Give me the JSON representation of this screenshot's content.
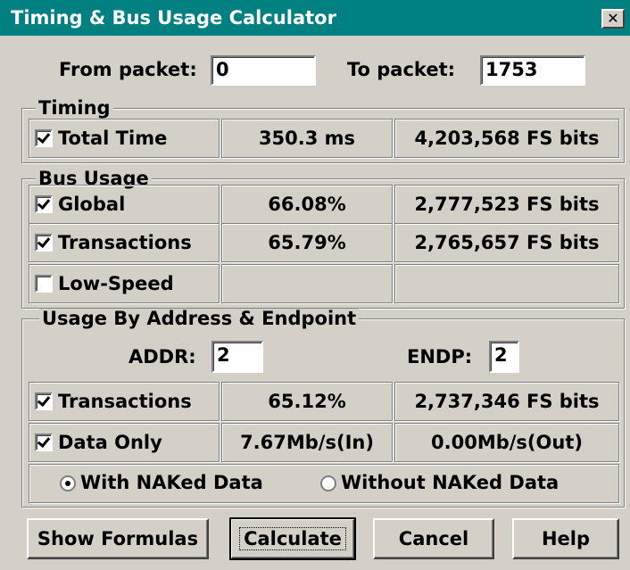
{
  "window": {
    "title": "Timing & Bus Usage Calculator",
    "close_symbol": "✕"
  },
  "range": {
    "from_label": "From packet:",
    "from_value": "0",
    "to_label": "To packet:",
    "to_value": "1753"
  },
  "timing": {
    "label": "Timing",
    "total_time": {
      "label": "Total Time",
      "checked": true,
      "value": "350.3 ms",
      "bits": "4,203,568 FS bits"
    }
  },
  "bus_usage": {
    "label": "Bus Usage",
    "global": {
      "label": "Global",
      "checked": true,
      "value": "66.08%",
      "bits": "2,777,523 FS bits"
    },
    "transactions": {
      "label": "Transactions",
      "checked": true,
      "value": "65.79%",
      "bits": "2,765,657 FS bits"
    },
    "low_speed": {
      "label": "Low-Speed",
      "checked": false,
      "value": "",
      "bits": ""
    }
  },
  "usage_by_address": {
    "label": "Usage By Address & Endpoint",
    "addr_label": "ADDR:",
    "addr_value": "2",
    "endp_label": "ENDP:",
    "endp_value": "2",
    "transactions": {
      "label": "Transactions",
      "checked": true,
      "value": "65.12%",
      "bits": "2,737,346 FS bits"
    },
    "data_only": {
      "label": "Data Only",
      "checked": true,
      "in_rate": "7.67Mb/s(In)",
      "out_rate": "0.00Mb/s(Out)"
    },
    "with_naked": {
      "label": "With NAKed Data",
      "selected": true
    },
    "without_naked": {
      "label": "Without NAKed Data",
      "selected": false
    }
  },
  "buttons": {
    "show_formulas": "Show Formulas",
    "calculate": "Calculate",
    "cancel": "Cancel",
    "help": "Help"
  },
  "colors": {
    "titlebar": "#008080",
    "face": "#d4d0c8"
  }
}
